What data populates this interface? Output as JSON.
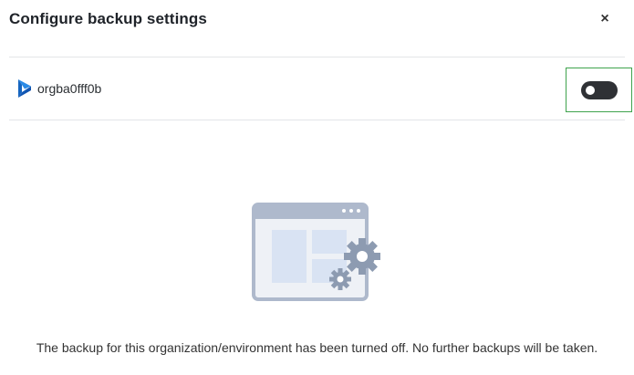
{
  "dialog": {
    "title": "Configure backup settings",
    "close_label": "×"
  },
  "organization": {
    "name": "orgba0fff0b",
    "icon": "dynamics-365-icon",
    "backup_enabled": false
  },
  "empty_state": {
    "icon": "settings-window-illustration",
    "message": "The backup for this organization/environment has been turned off. No further backups will be taken."
  },
  "colors": {
    "toggle_off": "#2f3135",
    "highlight_border": "#3fa34d",
    "illustration": "#aeb9cc"
  }
}
